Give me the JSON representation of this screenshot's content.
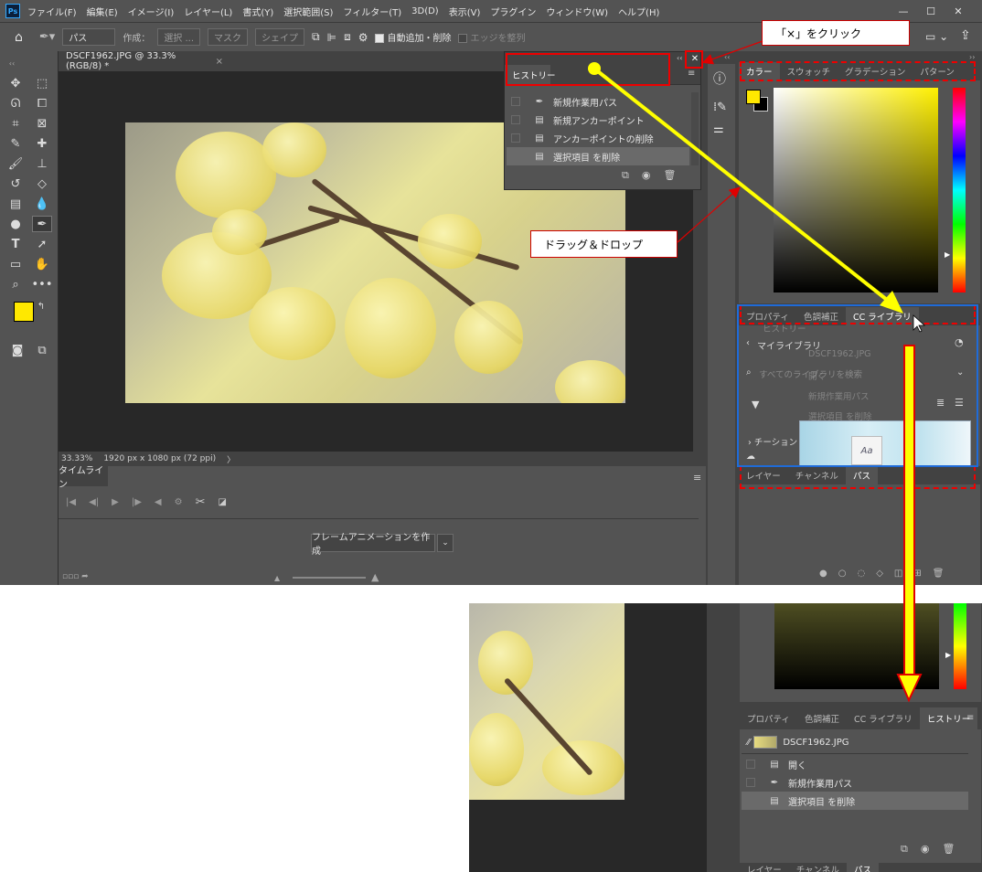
{
  "app": {
    "logo": "Ps",
    "menu": [
      "ファイル(F)",
      "編集(E)",
      "イメージ(I)",
      "レイヤー(L)",
      "書式(Y)",
      "選択範囲(S)",
      "フィルター(T)",
      "3D(D)",
      "表示(V)",
      "プラグイン",
      "ウィンドウ(W)",
      "ヘルプ(H)"
    ],
    "window_controls": [
      "—",
      "☐",
      "✕"
    ]
  },
  "options": {
    "mode": "パス",
    "make_label": "作成：",
    "select_btn": "選択 ...",
    "mask_btn": "マスク",
    "shape_btn": "シェイプ",
    "auto_add_label": "自動追加・削除",
    "align_edges_label": "エッジを整列"
  },
  "document": {
    "tab_title": "DSCF1962.JPG @ 33.3% (RGB/8) *",
    "close": "×",
    "zoom": "33.33%",
    "dimensions": "1920 px x 1080 px (72 ppi)",
    "chevron": "〉"
  },
  "timeline": {
    "tab": "タイムライン",
    "create_btn": "フレームアニメーションを作成"
  },
  "history_float": {
    "tab": "ヒストリー",
    "items": [
      {
        "label": "新規作業用パス",
        "icon": "pen-icon"
      },
      {
        "label": "新規アンカーポイント",
        "icon": "document-icon"
      },
      {
        "label": "アンカーポイントの削除",
        "icon": "document-icon"
      },
      {
        "label": "選択項目 を削除",
        "icon": "document-icon"
      }
    ]
  },
  "color_panel": {
    "tabs": [
      "カラー",
      "スウォッチ",
      "グラデーション",
      "パターン"
    ],
    "foreground": "#ffe800",
    "background": "#000000"
  },
  "mid_panel": {
    "tabs": [
      "プロパティ",
      "色調補正",
      "CC ライブラリ"
    ],
    "library_title": "マイライブラリ",
    "search_placeholder": "すべてのライブラリを検索",
    "ghost_items": [
      "ヒストリー",
      "DSCF1962.JPG",
      "開く",
      "新規作業用パス",
      "選択項目 を削除"
    ],
    "sample_text": "Aa",
    "section": "チーション"
  },
  "bottom_panel": {
    "tabs": [
      "レイヤー",
      "チャンネル",
      "パス"
    ]
  },
  "annotations": {
    "click_close": "「×」をクリック",
    "drag_drop": "ドラッグ＆ドロップ"
  },
  "result": {
    "tabs": [
      "プロパティ",
      "色調補正",
      "CC ライブラリ",
      "ヒストリー"
    ],
    "snapshot": "DSCF1962.JPG",
    "items": [
      "開く",
      "新規作業用パス",
      "選択項目 を削除"
    ],
    "bottom_tabs": [
      "レイヤー",
      "チャンネル",
      "パス"
    ]
  },
  "colors": {
    "annotation_red": "#e00000",
    "arrow_yellow": "#ffff00",
    "photo_yellow": "#efe07a"
  }
}
